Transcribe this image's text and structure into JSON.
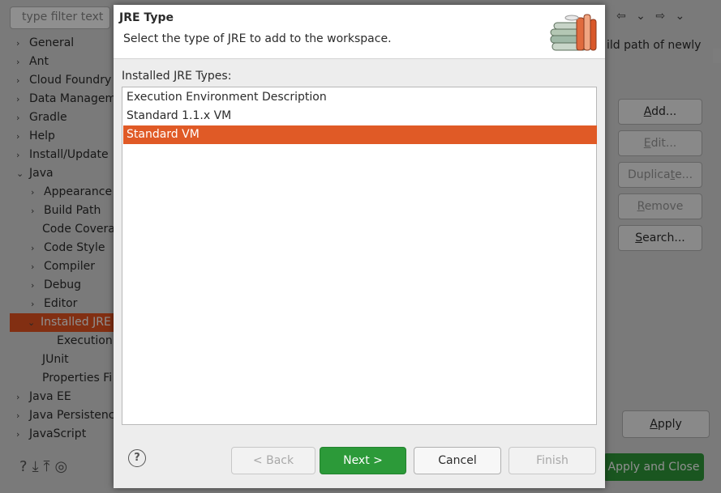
{
  "preferences": {
    "filter_placeholder": "type filter text",
    "tree": [
      {
        "label": "General",
        "arrow": "›"
      },
      {
        "label": "Ant",
        "arrow": "›"
      },
      {
        "label": "Cloud Foundry",
        "arrow": "›"
      },
      {
        "label": "Data Manageme",
        "arrow": "›"
      },
      {
        "label": "Gradle",
        "arrow": "›"
      },
      {
        "label": "Help",
        "arrow": "›"
      },
      {
        "label": "Install/Update",
        "arrow": "›"
      },
      {
        "label": "Java",
        "arrow": "⌄"
      },
      {
        "label": "Appearance",
        "arrow": "›"
      },
      {
        "label": "Build Path",
        "arrow": "›"
      },
      {
        "label": "Code Coverag",
        "arrow": ""
      },
      {
        "label": "Code Style",
        "arrow": "›"
      },
      {
        "label": "Compiler",
        "arrow": "›"
      },
      {
        "label": "Debug",
        "arrow": "›"
      },
      {
        "label": "Editor",
        "arrow": "›"
      },
      {
        "label": "Installed JRE",
        "arrow": "⌄"
      },
      {
        "label": "Execution",
        "arrow": ""
      },
      {
        "label": "JUnit",
        "arrow": ""
      },
      {
        "label": "Properties Fi",
        "arrow": ""
      },
      {
        "label": "Java EE",
        "arrow": "›"
      },
      {
        "label": "Java Persistence",
        "arrow": "›"
      },
      {
        "label": "JavaScript",
        "arrow": "›"
      }
    ],
    "hint_text": "ild path of newly",
    "side_buttons": {
      "add": "Add...",
      "edit": "Edit...",
      "duplicate": "Duplicate...",
      "remove": "Remove",
      "search": "Search..."
    },
    "apply": "Apply",
    "apply_close": "Apply and Close",
    "nav_glyphs": "⇦ ⌄ ⇨ ⌄"
  },
  "dialog": {
    "title": "JRE Type",
    "description": "Select the type of JRE to add to the workspace.",
    "list_label": "Installed JRE Types:",
    "items": [
      {
        "label": "Execution Environment Description",
        "selected": false
      },
      {
        "label": "Standard 1.1.x VM",
        "selected": false
      },
      {
        "label": "Standard VM",
        "selected": true
      }
    ],
    "buttons": {
      "back": "< Back",
      "next": "Next >",
      "cancel": "Cancel",
      "finish": "Finish"
    },
    "help_glyph": "?"
  },
  "colors": {
    "selection": "#e05a26",
    "primary_button": "#2c9a39"
  }
}
